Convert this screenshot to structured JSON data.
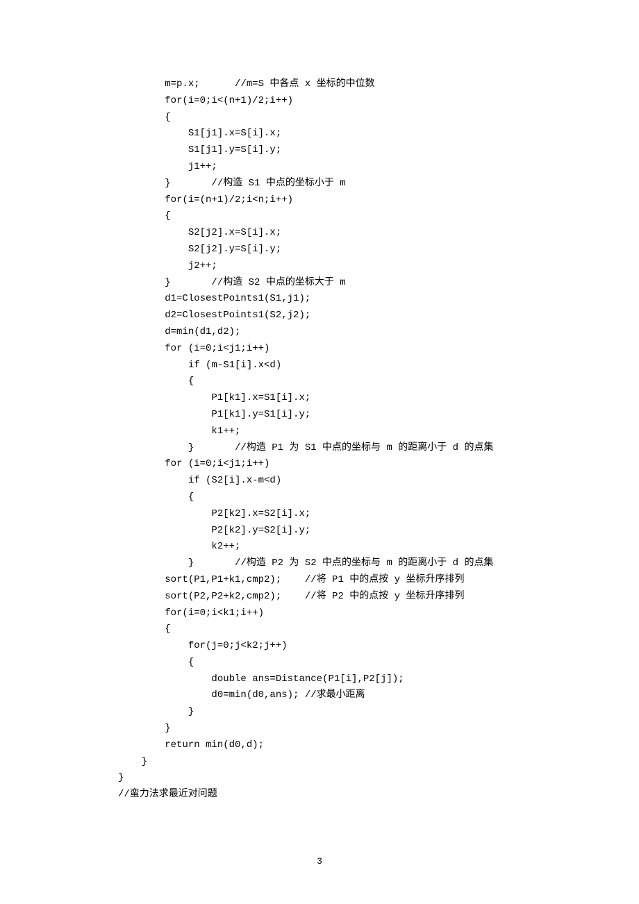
{
  "code": {
    "lines": [
      "        m=p.x;      //m=S 中各点 x 坐标的中位数",
      "        for(i=0;i<(n+1)/2;i++)",
      "        {",
      "            S1[j1].x=S[i].x;",
      "            S1[j1].y=S[i].y;",
      "            j1++;",
      "        }       //构造 S1 中点的坐标小于 m",
      "        for(i=(n+1)/2;i<n;i++)",
      "        {",
      "            S2[j2].x=S[i].x;",
      "            S2[j2].y=S[i].y;",
      "            j2++;",
      "        }       //构造 S2 中点的坐标大于 m",
      "        d1=ClosestPoints1(S1,j1);",
      "        d2=ClosestPoints1(S2,j2);",
      "        d=min(d1,d2);",
      "        for (i=0;i<j1;i++)",
      "            if (m-S1[i].x<d)",
      "            {",
      "                P1[k1].x=S1[i].x;",
      "                P1[k1].y=S1[i].y;",
      "                k1++;",
      "            }       //构造 P1 为 S1 中点的坐标与 m 的距离小于 d 的点集",
      "        for (i=0;i<j1;i++)",
      "            if (S2[i].x-m<d)",
      "            {",
      "                P2[k2].x=S2[i].x;",
      "                P2[k2].y=S2[i].y;",
      "                k2++;",
      "            }       //构造 P2 为 S2 中点的坐标与 m 的距离小于 d 的点集",
      "        sort(P1,P1+k1,cmp2);    //将 P1 中的点按 y 坐标升序排列",
      "        sort(P2,P2+k2,cmp2);    //将 P2 中的点按 y 坐标升序排列",
      "        for(i=0;i<k1;i++)",
      "        {",
      "            for(j=0;j<k2;j++)",
      "            {",
      "                double ans=Distance(P1[i],P2[j]);",
      "                d0=min(d0,ans); //求最小距离",
      "            }",
      "        }",
      "        return min(d0,d);",
      "    }",
      "}",
      "//蛮力法求最近对问题"
    ]
  },
  "pageNumber": "3"
}
